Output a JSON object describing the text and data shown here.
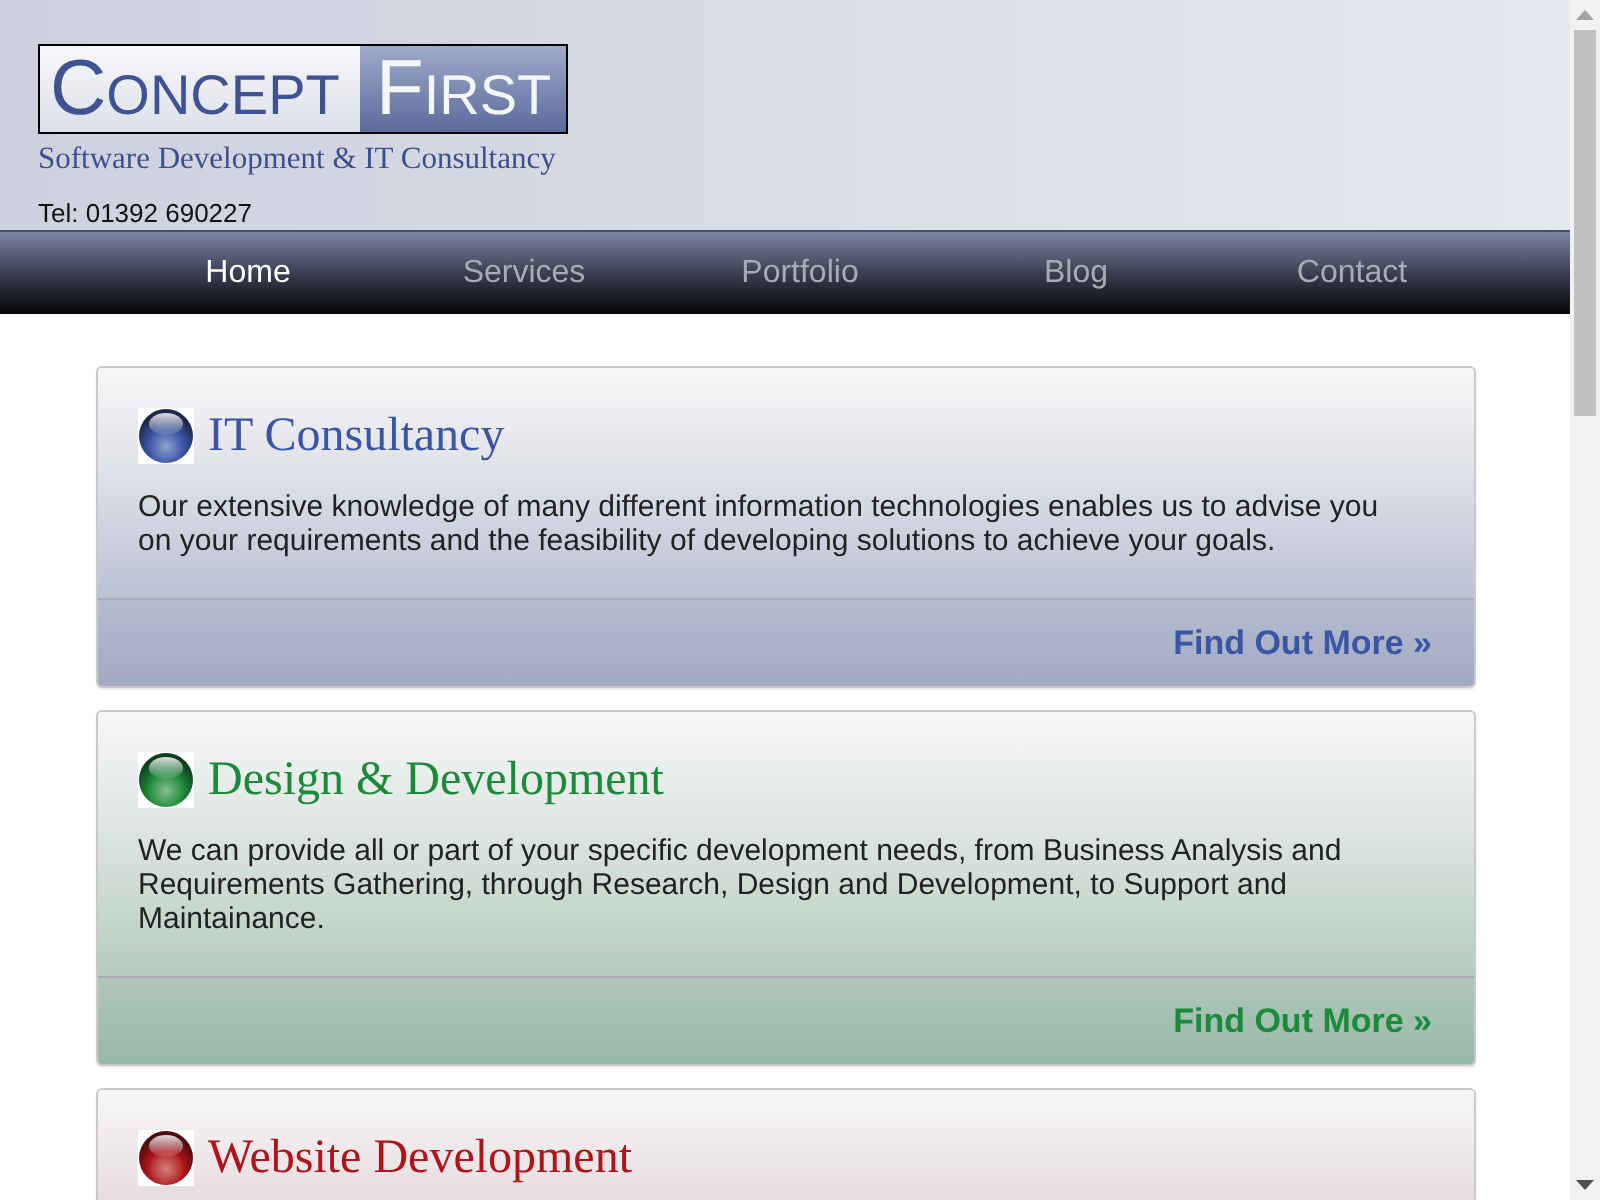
{
  "header": {
    "logo": {
      "word_1": "CONCEPT",
      "word_2": "FIRST"
    },
    "tagline": "Software Development & IT Consultancy",
    "phone": "Tel: 01392 690227"
  },
  "nav": [
    {
      "label": "Home",
      "selected": true
    },
    {
      "label": "Services",
      "selected": false
    },
    {
      "label": "Portfolio",
      "selected": false
    },
    {
      "label": "Blog",
      "selected": false
    },
    {
      "label": "Contact",
      "selected": false
    }
  ],
  "cards": [
    {
      "title": "IT Consultancy",
      "color": "#3b55a5",
      "text": "Our extensive knowledge of many different information technologies enables us to advise you on your requirements and the feasibility of developing solutions to achieve your goals.",
      "link": "Find Out More »"
    },
    {
      "title": "Design & Development",
      "color": "#1b8a3a",
      "text": "We can provide all or part of your specific development needs, from Business Analysis and Requirements Gathering, through Research, Design and Development, to Support and Maintainance.",
      "link": "Find Out More »"
    },
    {
      "title": "Website Development",
      "color": "#b0141a"
    }
  ]
}
